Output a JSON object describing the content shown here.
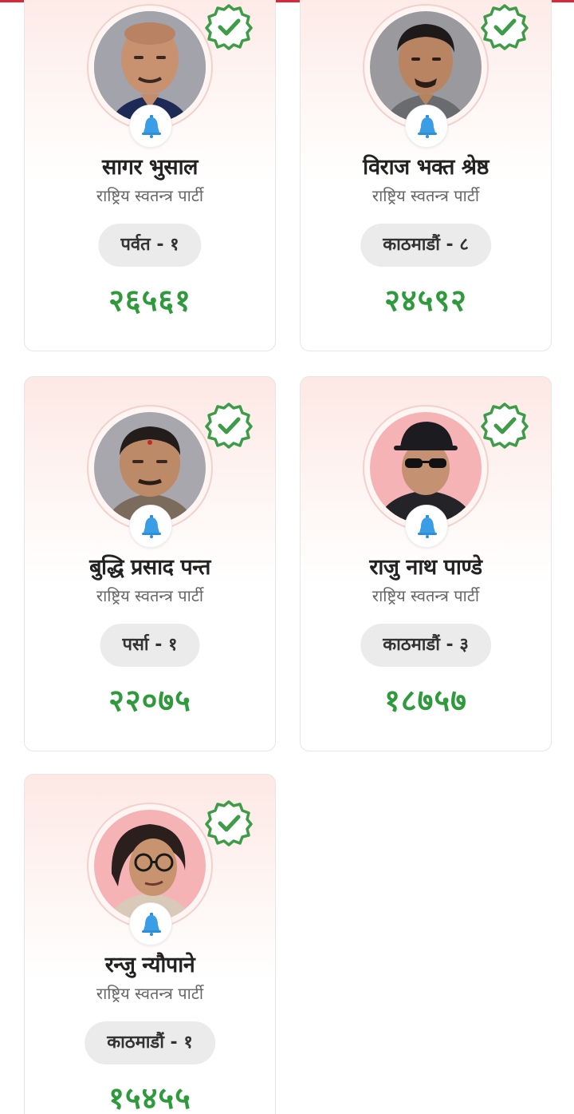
{
  "accent_color": "#d8283a",
  "vote_color": "#2e9a3c",
  "badge_icon": "verified-check-icon",
  "party_symbol_icon": "bell-icon",
  "candidates": [
    {
      "name": "सागर भुसाल",
      "party": "राष्ट्रिय स्वतन्त्र पार्टी",
      "constituency": "पर्वत - १",
      "votes": "२६५६१",
      "elected": true
    },
    {
      "name": "विराज भक्त श्रेष्ठ",
      "party": "राष्ट्रिय स्वतन्त्र पार्टी",
      "constituency": "काठमाडौं - ८",
      "votes": "२४५९२",
      "elected": true
    },
    {
      "name": "बुद्धि प्रसाद पन्त",
      "party": "राष्ट्रिय स्वतन्त्र पार्टी",
      "constituency": "पर्सा - १",
      "votes": "२२०७५",
      "elected": true
    },
    {
      "name": "राजु नाथ पाण्डे",
      "party": "राष्ट्रिय स्वतन्त्र पार्टी",
      "constituency": "काठमाडौं - ३",
      "votes": "१८७५७",
      "elected": true
    },
    {
      "name": "रन्जु न्यौपाने",
      "party": "राष्ट्रिय स्वतन्त्र पार्टी",
      "constituency": "काठमाडौं - १",
      "votes": "१५४५५",
      "elected": true
    }
  ]
}
